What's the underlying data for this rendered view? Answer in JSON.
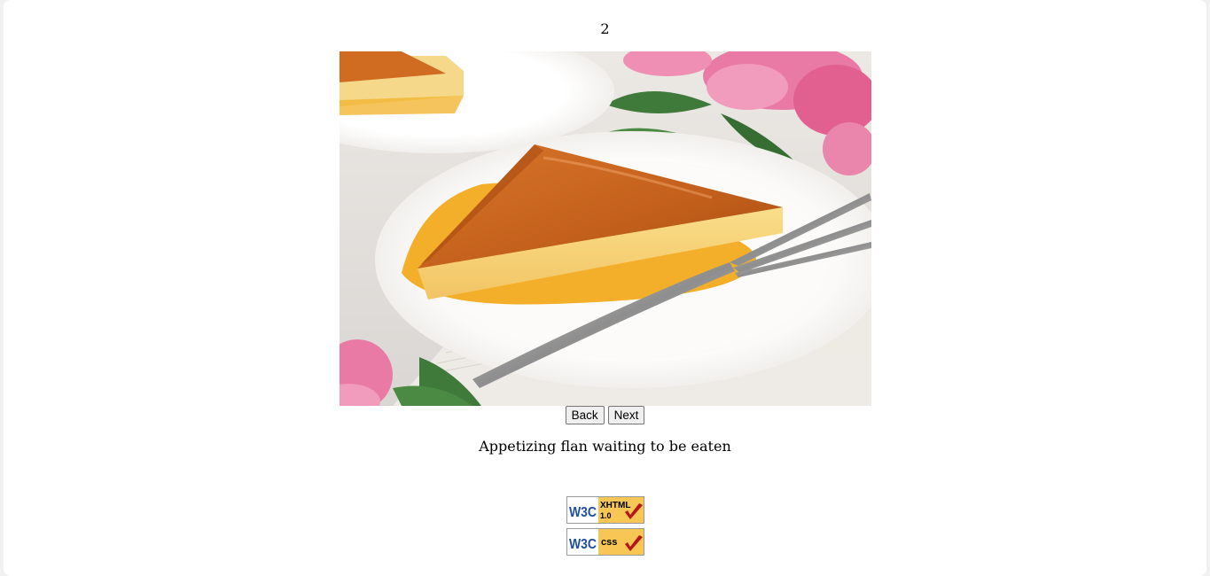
{
  "slideshow": {
    "counter": "2",
    "caption": "Appetizing flan waiting to be eaten",
    "back_label": "Back",
    "next_label": "Next"
  },
  "badges": {
    "xhtml": {
      "logo": "W3C",
      "label": "XHTML",
      "version": "1.0"
    },
    "css": {
      "logo": "W3C",
      "label": "css"
    }
  },
  "colors": {
    "caramel": "#c8631d",
    "custard": "#f7d27a",
    "sauce": "#f2a818",
    "plate": "#f7f4f0",
    "flowers": "#e97aa5",
    "leaves": "#3f7a3a",
    "badge_gold": "#f7c654",
    "w3c_blue": "#1f4f9c",
    "check_red": "#b4161b"
  }
}
